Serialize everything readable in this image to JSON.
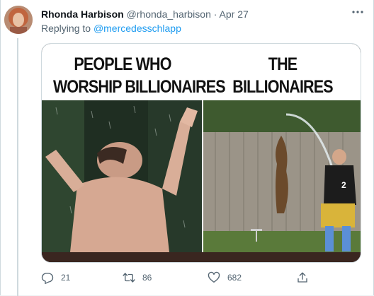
{
  "tweet": {
    "display_name": "Rhonda Harbison",
    "handle": "@rhonda_harbison",
    "separator": "·",
    "date": "Apr 27",
    "replying_prefix": "Replying to",
    "replying_to": "@mercedesschlapp"
  },
  "meme": {
    "left_line1": "PEOPLE WHO",
    "left_line2": "WORSHIP BILLIONAIRES",
    "right_line1": "THE",
    "right_line2": "BILLIONAIRES"
  },
  "actions": {
    "replies": "21",
    "retweets": "86",
    "likes": "682"
  },
  "icons": {
    "more": "more-dots-icon",
    "reply": "reply-icon",
    "retweet": "retweet-icon",
    "like": "heart-icon",
    "share": "share-icon"
  },
  "colors": {
    "link": "#1d9bf0",
    "secondary_text": "#536471",
    "primary_text": "#0f1419"
  }
}
